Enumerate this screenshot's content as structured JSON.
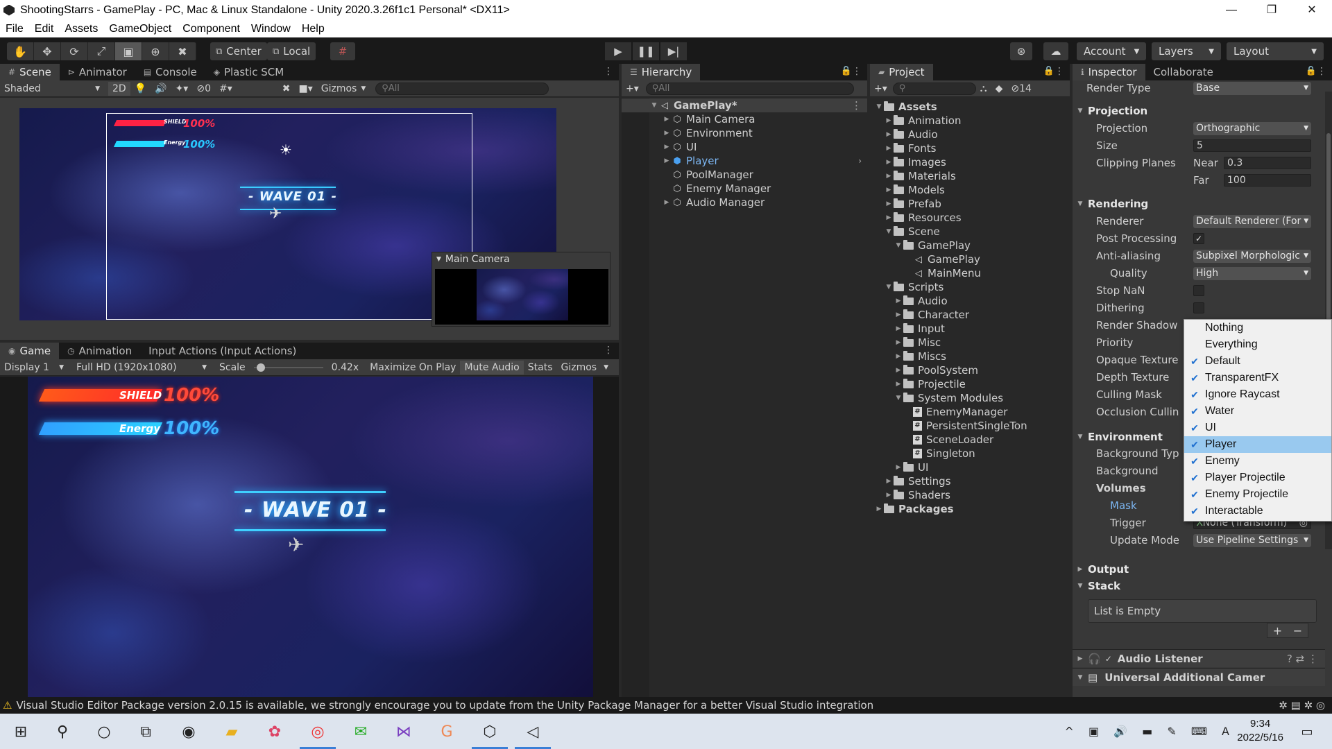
{
  "window": {
    "title": "ShootingStarrs - GamePlay - PC, Mac & Linux Standalone - Unity 2020.3.26f1c1 Personal* <DX11>"
  },
  "menu": [
    "File",
    "Edit",
    "Assets",
    "GameObject",
    "Component",
    "Window",
    "Help"
  ],
  "toolbar": {
    "pivot": "Center",
    "space": "Local",
    "account": "Account",
    "layers": "Layers",
    "layout": "Layout"
  },
  "scene": {
    "tabs": [
      "Scene",
      "Animator",
      "Console",
      "Plastic SCM"
    ],
    "shading": "Shaded",
    "mode2d": "2D",
    "hidden_count": "0",
    "gizmos": "Gizmos",
    "search_placeholder": "All",
    "camera_preview_title": "Main Camera"
  },
  "game": {
    "tabs": [
      "Game",
      "Animation",
      "Input Actions (Input Actions)"
    ],
    "display": "Display 1",
    "resolution": "Full HD (1920x1080)",
    "scale_label": "Scale",
    "scale_value": "0.42x",
    "scale_level": 0.05,
    "maximize": "Maximize On Play",
    "mute": "Mute Audio",
    "stats": "Stats",
    "gizmos": "Gizmos"
  },
  "hud": {
    "shield": "SHIELD",
    "energy": "Energy",
    "shield_pct": "100%",
    "energy_pct": "100%",
    "wave": "- WAVE 01 -"
  },
  "hierarchy": {
    "title": "Hierarchy",
    "search_placeholder": "All",
    "scene": "GamePlay*",
    "items": [
      "Main Camera",
      "Environment",
      "UI",
      "Player",
      "PoolManager",
      "Enemy Manager",
      "Audio Manager"
    ]
  },
  "project": {
    "title": "Project",
    "hidden_count": "14",
    "rows": [
      {
        "label": "Assets",
        "depth": 0,
        "open": true,
        "type": "folder"
      },
      {
        "label": "Animation",
        "depth": 1,
        "type": "folder"
      },
      {
        "label": "Audio",
        "depth": 1,
        "type": "folder"
      },
      {
        "label": "Fonts",
        "depth": 1,
        "type": "folder"
      },
      {
        "label": "Images",
        "depth": 1,
        "type": "folder"
      },
      {
        "label": "Materials",
        "depth": 1,
        "type": "folder"
      },
      {
        "label": "Models",
        "depth": 1,
        "type": "folder"
      },
      {
        "label": "Prefab",
        "depth": 1,
        "type": "folder"
      },
      {
        "label": "Resources",
        "depth": 1,
        "type": "folder"
      },
      {
        "label": "Scene",
        "depth": 1,
        "open": true,
        "type": "folder"
      },
      {
        "label": "GamePlay",
        "depth": 2,
        "open": true,
        "type": "folder"
      },
      {
        "label": "GamePlay",
        "depth": 3,
        "type": "scene"
      },
      {
        "label": "MainMenu",
        "depth": 3,
        "type": "scene"
      },
      {
        "label": "Scripts",
        "depth": 1,
        "open": true,
        "type": "folder"
      },
      {
        "label": "Audio",
        "depth": 2,
        "type": "folder"
      },
      {
        "label": "Character",
        "depth": 2,
        "type": "folder"
      },
      {
        "label": "Input",
        "depth": 2,
        "type": "folder"
      },
      {
        "label": "Misc",
        "depth": 2,
        "type": "folder"
      },
      {
        "label": "Miscs",
        "depth": 2,
        "type": "folder"
      },
      {
        "label": "PoolSystem",
        "depth": 2,
        "type": "folder"
      },
      {
        "label": "Projectile",
        "depth": 2,
        "type": "folder"
      },
      {
        "label": "System Modules",
        "depth": 2,
        "open": true,
        "type": "folder"
      },
      {
        "label": "EnemyManager",
        "depth": 3,
        "type": "script"
      },
      {
        "label": "PersistentSingleTon",
        "depth": 3,
        "type": "script"
      },
      {
        "label": "SceneLoader",
        "depth": 3,
        "type": "script"
      },
      {
        "label": "Singleton",
        "depth": 3,
        "type": "script"
      },
      {
        "label": "UI",
        "depth": 2,
        "type": "folder"
      },
      {
        "label": "Settings",
        "depth": 1,
        "type": "folder"
      },
      {
        "label": "Shaders",
        "depth": 1,
        "type": "folder"
      },
      {
        "label": "Packages",
        "depth": 0,
        "type": "folder"
      }
    ]
  },
  "inspector": {
    "tabs": [
      "Inspector",
      "Collaborate"
    ],
    "render_type_label": "Render Type",
    "render_type": "Base",
    "projection_header": "Projection",
    "projection_label": "Projection",
    "projection": "Orthographic",
    "size_label": "Size",
    "size": "5",
    "clipping_label": "Clipping Planes",
    "near_label": "Near",
    "near": "0.3",
    "far_label": "Far",
    "far": "100",
    "rendering_header": "Rendering",
    "renderer_label": "Renderer",
    "renderer": "Default Renderer (For",
    "post_label": "Post Processing",
    "aa_label": "Anti-aliasing",
    "aa": "Subpixel Morphologic",
    "quality_label": "Quality",
    "quality": "High",
    "stopnan_label": "Stop NaN",
    "dithering_label": "Dithering",
    "shadow_label": "Render Shadow",
    "priority_label": "Priority",
    "opaque_label": "Opaque Texture",
    "depth_label": "Depth Texture",
    "culling_label": "Culling Mask",
    "occlusion_label": "Occlusion Cullin",
    "environment_header": "Environment",
    "bgtype_label": "Background Typ",
    "bg_label": "Background",
    "volumes_label": "Volumes",
    "mask_label": "Mask",
    "trigger_label": "Trigger",
    "trigger": "None (Transform)",
    "update_label": "Update Mode",
    "update": "Use Pipeline Settings",
    "output_header": "Output",
    "stack_header": "Stack",
    "stack_empty": "List is Empty",
    "audio_listener": "Audio Listener",
    "additional_camera": "Universal Additional Camer"
  },
  "layer_popup": [
    {
      "label": "Nothing",
      "checked": false
    },
    {
      "label": "Everything",
      "checked": false
    },
    {
      "label": "Default",
      "checked": true
    },
    {
      "label": "TransparentFX",
      "checked": true
    },
    {
      "label": "Ignore Raycast",
      "checked": true
    },
    {
      "label": "Water",
      "checked": true
    },
    {
      "label": "UI",
      "checked": true
    },
    {
      "label": "Player",
      "checked": true,
      "highlight": true
    },
    {
      "label": "Enemy",
      "checked": true
    },
    {
      "label": "Player Projectile",
      "checked": true
    },
    {
      "label": "Enemy Projectile",
      "checked": true
    },
    {
      "label": "Interactable",
      "checked": true
    }
  ],
  "status": "Visual Studio Editor Package version 2.0.15 is available, we strongly encourage you to update from the Unity Package Manager for a better Visual Studio integration",
  "taskbar": {
    "time": "9:34",
    "date": "2022/5/16"
  }
}
